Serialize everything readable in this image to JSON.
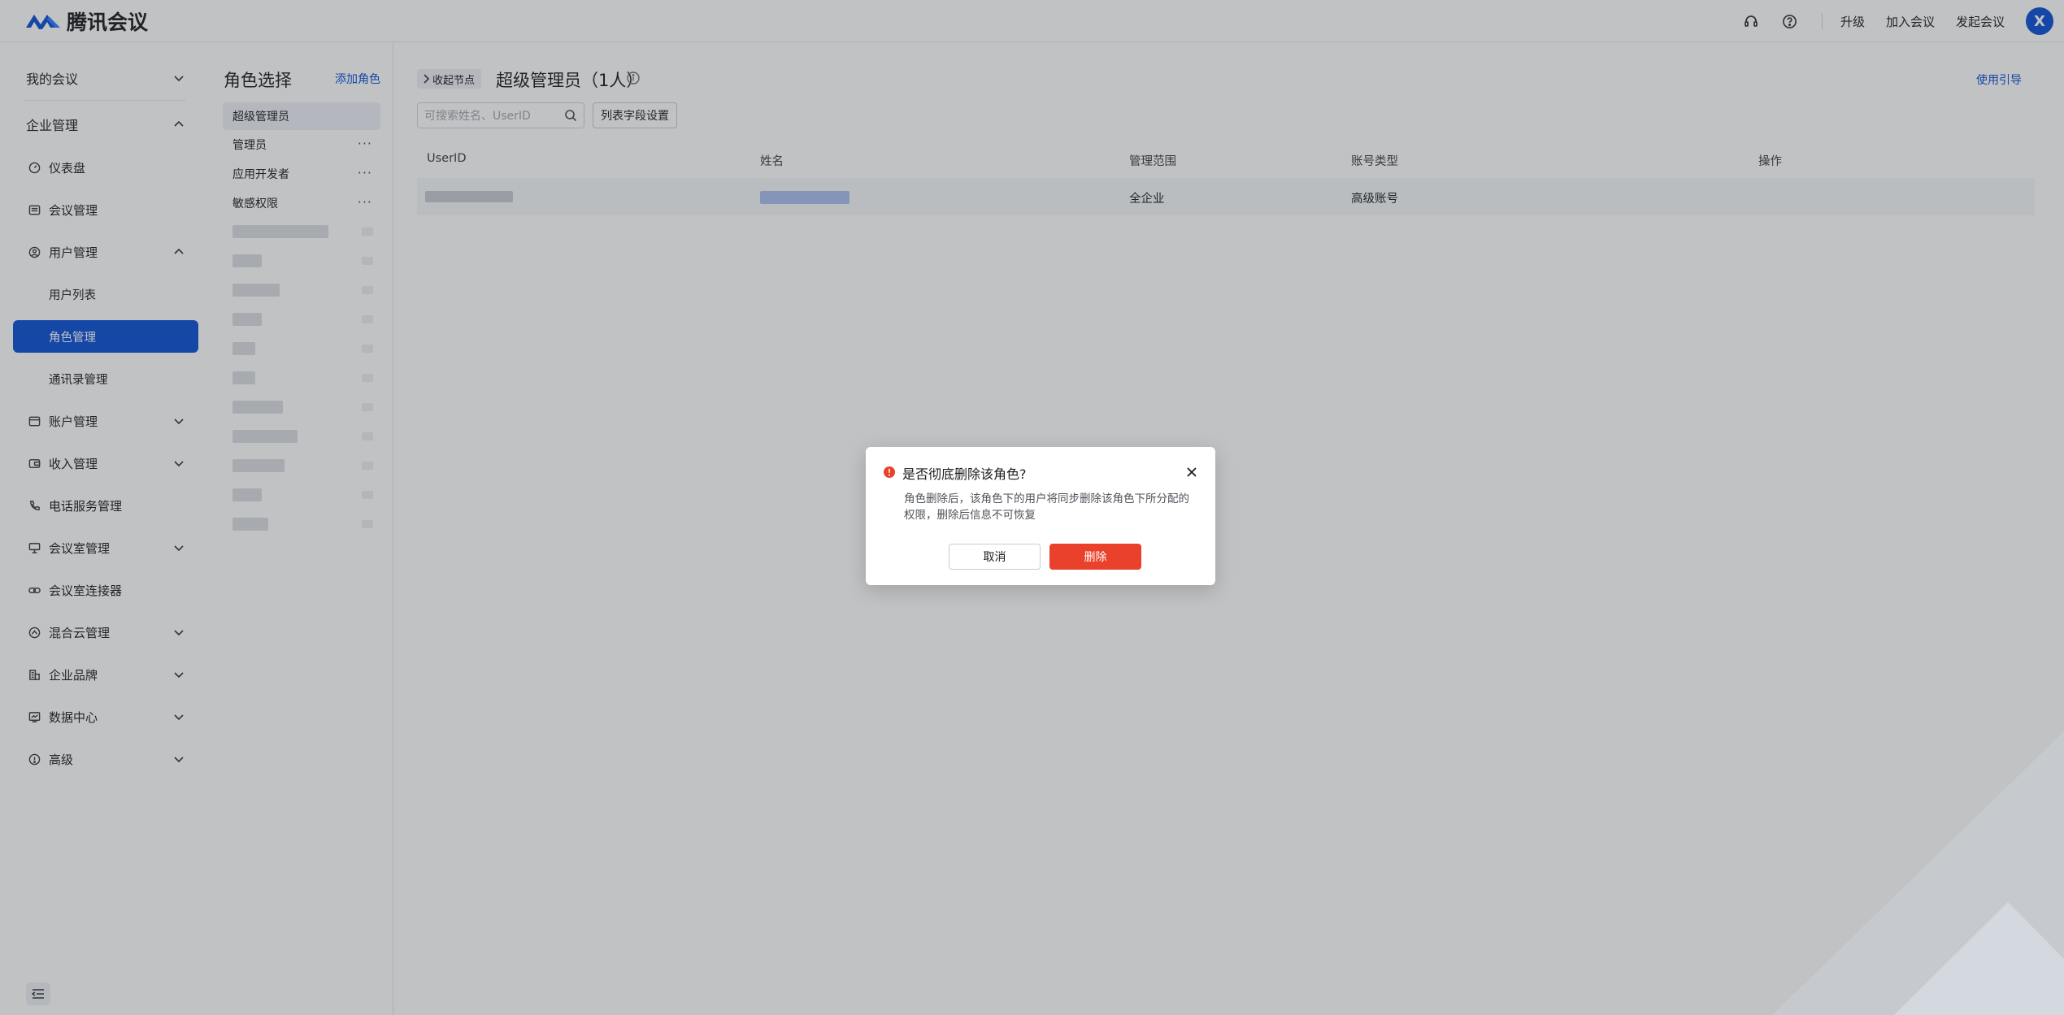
{
  "app": {
    "name": "腾讯会议"
  },
  "header": {
    "upgrade_label": "升级",
    "join_label": "加入会议",
    "start_label": "发起会议",
    "avatar_letter": "X"
  },
  "sidebar": {
    "my_meetings": "我的会议",
    "enterprise": "企业管理",
    "items": {
      "dashboard": "仪表盘",
      "meeting_mgmt": "会议管理",
      "user_mgmt": "用户管理",
      "user_list": "用户列表",
      "role_mgmt": "角色管理",
      "contacts_mgmt": "通讯录管理",
      "account_mgmt": "账户管理",
      "income_mgmt": "收入管理",
      "phone_service": "电话服务管理",
      "room_mgmt": "会议室管理",
      "room_connector": "会议室连接器",
      "hybrid_cloud": "混合云管理",
      "brand": "企业品牌",
      "data_center": "数据中心",
      "advanced": "高级"
    }
  },
  "roles": {
    "title": "角色选择",
    "add_label": "添加角色",
    "items": [
      "超级管理员",
      "管理员",
      "应用开发者",
      "敏感权限"
    ],
    "more": "···"
  },
  "main": {
    "collapse_label": "收起节点",
    "title": "超级管理员（1人）",
    "guide_label": "使用引导",
    "search_placeholder": "可搜索姓名、UserID",
    "fields_button": "列表字段设置",
    "columns": [
      "UserID",
      "姓名",
      "管理范围",
      "账号类型",
      "操作"
    ],
    "row": {
      "scope": "全企业",
      "account_type": "高级账号"
    }
  },
  "dialog": {
    "title": "是否彻底删除该角色?",
    "body": "角色删除后，该角色下的用户将同步删除该角色下所分配的权限，删除后信息不可恢复",
    "cancel_label": "取消",
    "delete_label": "删除"
  },
  "colors": {
    "brand_blue": "#0b4fd6",
    "danger_red": "#e9412b"
  }
}
